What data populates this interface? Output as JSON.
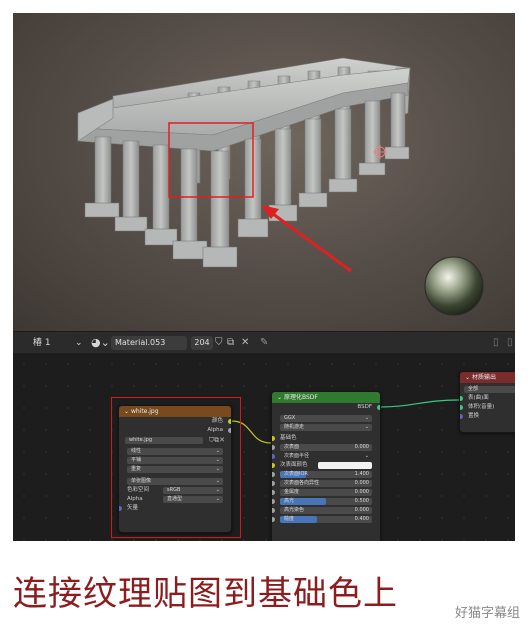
{
  "header": {
    "object_name": "椿 1",
    "material_name": "Material.053",
    "user_count": "204"
  },
  "image_texture_node": {
    "title": "white.jpg",
    "outputs": [
      "颜色",
      "Alpha"
    ],
    "image_name": "white.jpg",
    "interpolation": "线性",
    "projection": "平铺",
    "extension": "重复",
    "source": "单张图像",
    "color_space_label": "色彩空间",
    "color_space_value": "sRGB",
    "alpha_label": "Alpha",
    "alpha_value": "直通型",
    "vector_label": "矢量"
  },
  "bsdf_node": {
    "title": "原理化BSDF",
    "output": "BSDF",
    "distribution": "GGX",
    "subsurface_method": "随机游走",
    "base_color_label": "基础色",
    "rows": [
      {
        "label": "次表面",
        "value": "0.000",
        "fill": 0
      },
      {
        "label": "次表面半径",
        "value": "",
        "fill": 0
      },
      {
        "label": "次表面颜色",
        "value": "",
        "fill": 0
      },
      {
        "label": "次表面IOR",
        "value": "1.400",
        "fill": 0.28
      },
      {
        "label": "次表面各向异性",
        "value": "0.000",
        "fill": 0
      },
      {
        "label": "金属度",
        "value": "0.000",
        "fill": 0
      },
      {
        "label": "高光",
        "value": "0.500",
        "fill": 0.5
      },
      {
        "label": "高光染色",
        "value": "0.000",
        "fill": 0
      },
      {
        "label": "糙度",
        "value": "0.400",
        "fill": 0.4
      }
    ]
  },
  "output_node": {
    "title": "材质输出",
    "target": "全部",
    "inputs": [
      "表(曲)面",
      "体积(音量)",
      "置换"
    ]
  },
  "caption": "连接纹理贴图到基础色上",
  "watermark": "好猫字幕组",
  "colors": {
    "color_socket": "#c7c729",
    "float_socket": "#a1a1a1",
    "shader_socket": "#39c884",
    "vector_socket": "#6363c7",
    "highlight": "#e02020"
  }
}
